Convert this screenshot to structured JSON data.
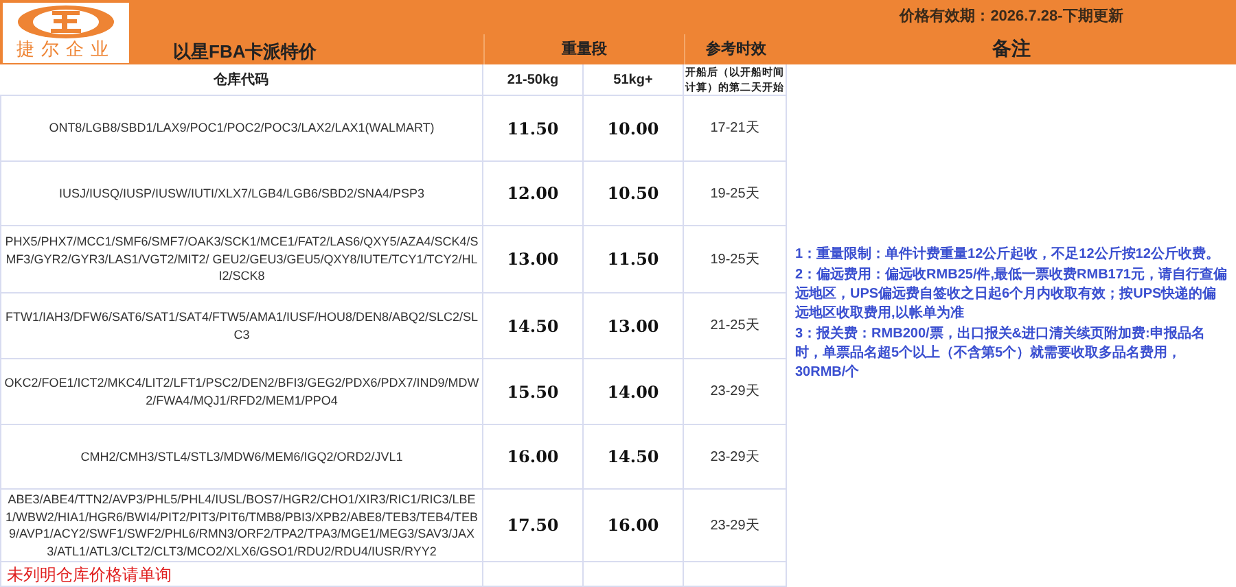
{
  "logo": {
    "text": "捷尔企业"
  },
  "validity": "价格有效期：2026.7.28-下期更新",
  "title": "以星FBA卡派特价",
  "header": {
    "weight_band": "重量段",
    "reference_time": "参考时效",
    "notes": "备注"
  },
  "columns": [
    "仓库代码",
    "21-50kg",
    "51kg+",
    "开船后（以开船时间计算）的第二天开始"
  ],
  "rows": [
    {
      "codes": "ONT8/LGB8/SBD1/LAX9/POC1/POC2/POC3/LAX2/LAX1(WALMART)",
      "price_21_50": "11.50",
      "price_51": "10.00",
      "time": "17-21天"
    },
    {
      "codes": "IUSJ/IUSQ/IUSP/IUSW/IUTI/XLX7/LGB4/LGB6/SBD2/SNA4/PSP3",
      "price_21_50": "12.00",
      "price_51": "10.50",
      "time": "19-25天"
    },
    {
      "codes": "PHX5/PHX7/MCC1/SMF6/SMF7/OAK3/SCK1/MCE1/FAT2/LAS6/QXY5/AZA4/SCK4/SMF3/GYR2/GYR3/LAS1/VGT2/MIT2/ GEU2/GEU3/GEU5/QXY8/IUTE/TCY1/TCY2/HLI2/SCK8",
      "price_21_50": "13.00",
      "price_51": "11.50",
      "time": "19-25天"
    },
    {
      "codes": "FTW1/IAH3/DFW6/SAT6/SAT1/SAT4/FTW5/AMA1/IUSF/HOU8/DEN8/ABQ2/SLC2/SLC3",
      "price_21_50": "14.50",
      "price_51": "13.00",
      "time": "21-25天"
    },
    {
      "codes": "OKC2/FOE1/ICT2/MKC4/LIT2/LFT1/PSC2/DEN2/BFI3/GEG2/PDX6/PDX7/IND9/MDW2/FWA4/MQJ1/RFD2/MEM1/PPO4",
      "price_21_50": "15.50",
      "price_51": "14.00",
      "time": "23-29天"
    },
    {
      "codes": "CMH2/CMH3/STL4/STL3/MDW6/MEM6/IGQ2/ORD2/JVL1",
      "price_21_50": "16.00",
      "price_51": "14.50",
      "time": "23-29天"
    },
    {
      "codes": "ABE3/ABE4/TTN2/AVP3/PHL5/PHL4/IUSL/BOS7/HGR2/CHO1/XIR3/RIC1/RIC3/LBE1/WBW2/HIA1/HGR6/BWI4/PIT2/PIT3/PIT6/TMB8/PBI3/XPB2/ABE8/TEB3/TEB4/TEB9/AVP1/ACY2/SWF1/SWF2/PHL6/RMN3/ORF2/TPA2/TPA3/MGE1/MEG3/SAV3/JAX3/ATL1/ATL3/CLT2/CLT3/MCO2/XLX6/GSO1/RDU2/RDU4/IUSR/RYY2",
      "price_21_50": "17.50",
      "price_51": "16.00",
      "time": "23-29天"
    }
  ],
  "notes": [
    "1：重量限制：单件计费重量12公斤起收，不足12公斤按12公斤收费。",
    "2：偏远费用：偏远收RMB25/件,最低一票收费RMB171元，请自行查偏远地区，UPS偏远费自签收之日起6个月内收取有效；按UPS快递的偏远地区收取费用,以帐单为准",
    "3：报关费：RMB200/票，出口报关&进口清关续页附加费:申报品名时，单票品名超5个以上（不含第5个）就需要收取多品名费用，30RMB/个"
  ],
  "footer_note": "未列明仓库价格请单询"
}
